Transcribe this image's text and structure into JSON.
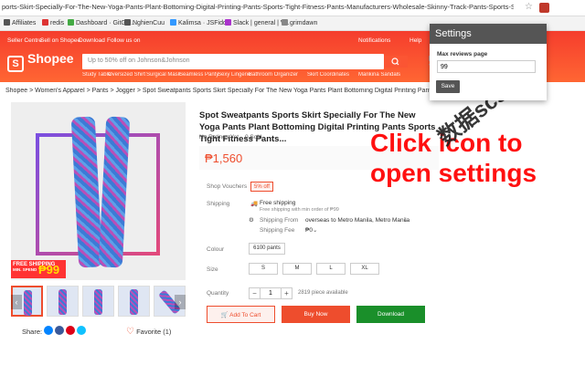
{
  "browser": {
    "url": "ports-Skirt-Specially-For-The-New-Yoga-Pants-Plant-Bottoming-Digital-Printing-Pants-Sports-Tight-Fitness-Pants-Manufacturers-Wholesale-Skinny-Track-Pants-Sports-Short-Skirt-i.109584294.6842...",
    "bookmarks": [
      "Affiliates",
      "redis",
      "Dashboard · GitGo...",
      "NghienCuu",
      "Kalimsa · JSFiddle",
      "Slack | general | V...",
      "grimdawn"
    ]
  },
  "shopee": {
    "seller_centre": "Seller Centre",
    "sell_on": "Sell on Shopee",
    "download": "Download",
    "follow_us": "Follow us on",
    "notifications": "Notifications",
    "help": "Help",
    "logo": "Shopee",
    "search_placeholder": "Up to 50% off on Johnson&Johnson",
    "hot_words": [
      "Study Table",
      "Oversized Shirt",
      "Surgical Mask",
      "Seamless Panty",
      "Sexy Lingerie",
      "Bathroom Organizer",
      "Skirt Coordinates",
      "Marikina Sandals"
    ]
  },
  "breadcrumb": "Shopee > Women's Apparel > Pants > Jogger > Spot Sweatpants Sports Skirt Specially For The New Yoga Pants Plant Bottoming Digital Printing Pants Sports Tight Fitness Pants M...",
  "product": {
    "title": "Spot Sweatpants Sports Skirt Specially For The New Yoga Pants Plant Bottoming Digital Printing Pants Sports Tight Fitness Pants...",
    "ratings": "No Ratings Yet",
    "sold": "0 Sold",
    "price": "₱1,560",
    "free_shipping_badge": "FREE SHIPPING",
    "free_shipping_min": "MIN. SPEND",
    "free_shipping_amount": "₱99",
    "shop_vouchers_label": "Shop Vouchers",
    "shop_vouchers_value": "5% off",
    "shipping_label": "Shipping",
    "free_shipping": "Free shipping",
    "free_shipping_note": "Free shipping with min order of ₱99",
    "shipping_from_label": "Shipping From",
    "shipping_from_value": "overseas to Metro Manila, Metro Manila",
    "shipping_fee_label": "Shipping Fee",
    "shipping_fee_value": "₱0",
    "colour_label": "Colour",
    "colour_option": "6100 pants",
    "size_label": "Size",
    "sizes": [
      "S",
      "M",
      "L",
      "XL"
    ],
    "quantity_label": "Quantity",
    "quantity_value": "1",
    "pieces_available": "2819 piece available",
    "add_to_cart": "Add To Cart",
    "buy_now": "Buy Now",
    "download_btn": "Download",
    "share_label": "Share:",
    "favorite": "Favorite (1)"
  },
  "overlay": {
    "line1": "Click icon to",
    "line2": "open settings",
    "watermark": "数据scs66"
  },
  "popup": {
    "title": "Settings",
    "field_label": "Max reviews page",
    "field_value": "99",
    "save": "Save"
  },
  "colors": {
    "shopee_orange": "#ee4d2d",
    "download_green": "#1a8f2a",
    "overlay_red": "#ff1010"
  }
}
